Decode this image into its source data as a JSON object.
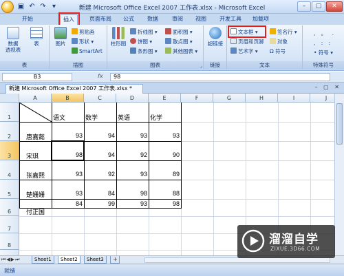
{
  "window": {
    "title": "新建 Microsoft Office Excel 2007 工作表.xlsx - Microsoft Excel",
    "qat_icons": [
      "save-icon",
      "undo-icon",
      "redo-icon",
      "customize-icon"
    ]
  },
  "tabs": [
    "开始",
    "插入",
    "页面布局",
    "公式",
    "数据",
    "审阅",
    "视图",
    "开发工具",
    "加载项"
  ],
  "ribbon": {
    "groups": {
      "tables": {
        "label": "表",
        "pivot": "数据\n透视表",
        "table": "表"
      },
      "illustrations": {
        "label": "插图",
        "picture": "图片",
        "clipart": "剪贴画",
        "shapes": "形状",
        "smartart": "SmartArt"
      },
      "charts": {
        "label": "图表",
        "column": "柱形图",
        "line": "折线图",
        "pie": "饼图",
        "bar": "条形图",
        "area": "面积图",
        "scatter": "散点图",
        "other": "其他图表"
      },
      "links": {
        "label": "链接",
        "hyperlink": "超链接"
      },
      "text": {
        "label": "文本",
        "textbox": "文本框",
        "header_footer": "页眉和页脚",
        "wordart": "艺术字",
        "signature": "签名行",
        "object": "对象",
        "symbol": "符号"
      },
      "special": {
        "label": "特殊符号",
        "symbol": "符号"
      }
    }
  },
  "formula_bar": {
    "name_box": "B3",
    "fx": "fx",
    "value": "98"
  },
  "workbook_tab": "新建 Microsoft Office Excel 2007 工作表.xlsx *",
  "grid": {
    "columns": [
      "A",
      "B",
      "C",
      "D",
      "E",
      "F",
      "G",
      "H",
      "I",
      "J"
    ],
    "rows": [
      "1",
      "2",
      "3",
      "4",
      "5",
      "6",
      "7",
      "8",
      "9"
    ],
    "selected_cell": "B3",
    "headers": [
      "语文",
      "数学",
      "英语",
      "化学"
    ],
    "names": [
      "唐嘉懿",
      "宋琪",
      "张嘉熙",
      "楚姗姗",
      "付正国"
    ],
    "scores": [
      [
        "93",
        "94",
        "93",
        "93"
      ],
      [
        "98",
        "94",
        "92",
        "90"
      ],
      [
        "93",
        "92",
        "93",
        "89"
      ],
      [
        "93",
        "84",
        "98",
        "88"
      ],
      [
        "84",
        "99",
        "93",
        "98"
      ]
    ]
  },
  "sheets": [
    "Sheet1",
    "Sheet2",
    "Sheet3"
  ],
  "active_sheet": "Sheet2",
  "status": "就绪",
  "watermark": {
    "title": "溜溜自学",
    "url": "ZIXUE.3D66.COM"
  }
}
